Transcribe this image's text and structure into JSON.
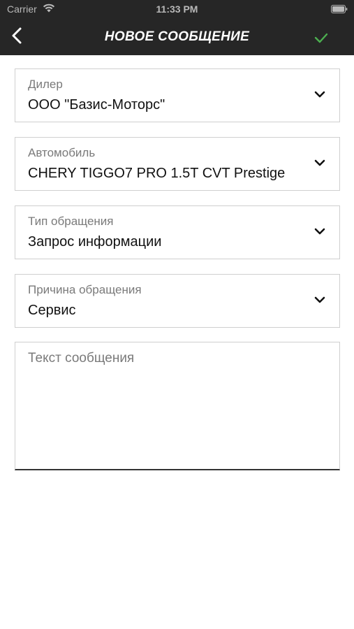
{
  "status_bar": {
    "carrier": "Carrier",
    "time": "11:33 PM"
  },
  "nav": {
    "title": "НОВОЕ СООБЩЕНИЕ",
    "back_icon": "chevron-left-icon",
    "confirm_icon": "checkmark-icon",
    "confirm_color": "#4caf50"
  },
  "fields": [
    {
      "label": "Дилер",
      "value": "ООО \"Базис-Моторс\""
    },
    {
      "label": "Автомобиль",
      "value": "CHERY TIGGO7 PRO 1.5T CVT Prestige"
    },
    {
      "label": "Тип обращения",
      "value": "Запрос информации"
    },
    {
      "label": "Причина обращения",
      "value": "Сервис"
    }
  ],
  "message": {
    "placeholder": "Текст сообщения",
    "value": ""
  },
  "colors": {
    "header_background": "#262626",
    "accent": "#4caf50"
  }
}
